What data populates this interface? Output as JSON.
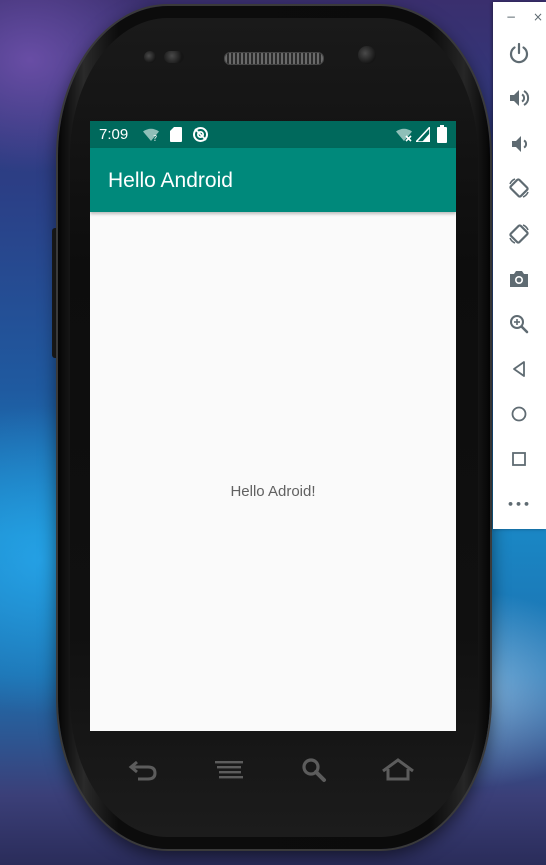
{
  "device": {
    "status_bar": {
      "time": "7:09",
      "icons": [
        "wifi-question-icon",
        "sd-card-icon",
        "sync-disabled-icon",
        "wifi-off-icon",
        "signal-icon",
        "battery-icon"
      ]
    },
    "app_bar": {
      "title": "Hello Android"
    },
    "content": {
      "message": "Hello Adroid!"
    },
    "nav_keys": [
      "back-key-icon",
      "menu-key-icon",
      "search-key-icon",
      "home-key-icon"
    ]
  },
  "emulator_toolbar": {
    "window_controls": {
      "minimize": "−",
      "close": "×"
    },
    "buttons": [
      "power-icon",
      "volume-up-icon",
      "volume-down-icon",
      "rotate-left-icon",
      "rotate-right-icon",
      "camera-icon",
      "zoom-icon",
      "back-icon",
      "home-icon",
      "overview-icon",
      "more-icon"
    ],
    "more_label": "•••"
  },
  "colors": {
    "status_bar": "#00695c",
    "app_bar": "#00897b",
    "screen_background": "#fafafa",
    "toolbar_icon": "#5f6b72"
  }
}
